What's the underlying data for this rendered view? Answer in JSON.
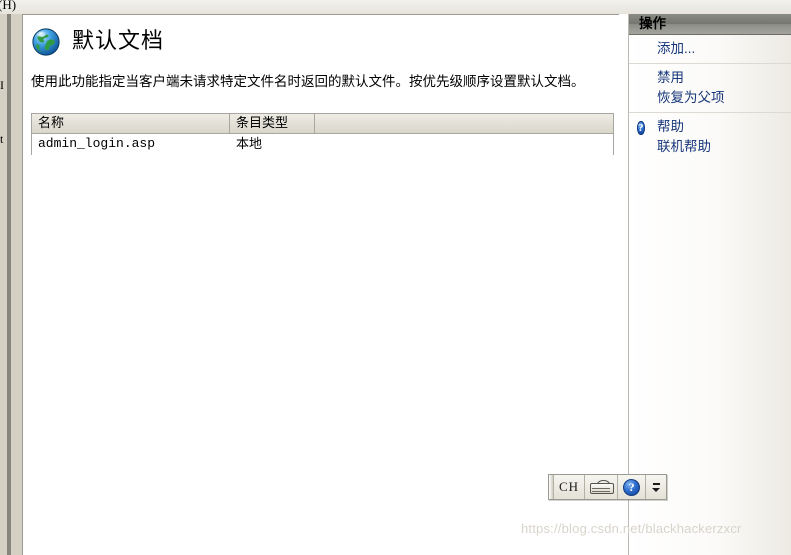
{
  "window": {
    "menu_tail": "(H)",
    "clipped_fragments": [
      "I",
      "t"
    ]
  },
  "main": {
    "icon": "globe-icon",
    "title": "默认文档",
    "description": "使用此功能指定当客户端未请求特定文件名时返回的默认文件。按优先级顺序设置默认文档。",
    "grid": {
      "columns": [
        "名称",
        "条目类型",
        ""
      ],
      "rows": [
        {
          "name": "admin_login.asp",
          "type": "本地"
        }
      ]
    }
  },
  "actions": {
    "title": "操作",
    "groups": [
      {
        "items": [
          {
            "label": "添加...",
            "icon": ""
          }
        ]
      },
      {
        "items": [
          {
            "label": "禁用",
            "icon": ""
          },
          {
            "label": "恢复为父项",
            "icon": ""
          }
        ]
      },
      {
        "items": [
          {
            "label": "帮助",
            "icon": "help-icon"
          },
          {
            "label": "联机帮助",
            "icon": ""
          }
        ]
      }
    ]
  },
  "ime_bar": {
    "mode_label": "CH",
    "keyboard_icon": "keyboard-icon",
    "help_icon": "help-icon",
    "minimize_icon": "minimize-icon",
    "expand_icon": "chevron-down-icon"
  },
  "watermark": {
    "text": "https://blog.csdn.net/blackhackerzxcr"
  },
  "colors": {
    "link": "#17377a",
    "actions_header_bg": "#76766f",
    "grid_header_bg": "#d9d6ca",
    "panel_border": "#9a9a93",
    "watermark": "#d8d4cb"
  }
}
